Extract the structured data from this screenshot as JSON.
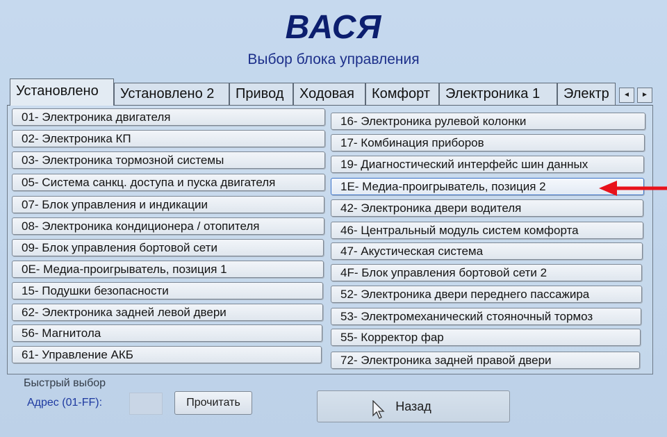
{
  "app": {
    "title": "ВАСЯ",
    "subtitle": "Выбор блока управления"
  },
  "tabs": [
    {
      "label": "Установлено",
      "active": true
    },
    {
      "label": "Установлено 2"
    },
    {
      "label": "Привод"
    },
    {
      "label": "Ходовая"
    },
    {
      "label": "Комфорт"
    },
    {
      "label": "Электроника 1"
    },
    {
      "label": "Электр"
    }
  ],
  "tab_nav": {
    "prev_icon": "◄",
    "next_icon": "►"
  },
  "modules_left": [
    "01- Электроника двигателя",
    "02- Электроника КП",
    "03- Электроника тормозной системы",
    "05- Система санкц. доступа и пуска двигателя",
    "07- Блок управления и индикации",
    "08- Электроника кондиционера / отопителя",
    "09- Блок управления бортовой сети",
    "0E- Медиа-проигрыватель, позиция 1",
    "15- Подушки безопасности",
    "62- Электроника задней левой двери",
    "56- Магнитола",
    "61- Управление АКБ"
  ],
  "modules_right": [
    "16- Электроника рулевой колонки",
    "17- Комбинация приборов",
    "19- Диагностический интерфейс шин данных",
    "1E- Медиа-проигрыватель, позиция 2",
    "42- Электроника двери водителя",
    "46- Центральный модуль систем комфорта",
    "47- Акустическая система",
    "4F- Блок управления бортовой сети 2",
    "52- Электроника двери переднего пассажира",
    "53- Электромеханический стояночный тормоз",
    "55- Корректор фар",
    "72- Электроника задней правой двери"
  ],
  "selected_module": "1E- Медиа-проигрыватель, позиция 2",
  "quick_select": {
    "title": "Быстрый выбор",
    "address_label": "Адрес (01-FF):",
    "address_value": "",
    "read_button": "Прочитать"
  },
  "back_button": "Назад",
  "colors": {
    "title": "#0c1e6e",
    "subtitle": "#1c2f8a",
    "annotation_arrow": "#e8121b",
    "background": "#c4d7eb"
  }
}
